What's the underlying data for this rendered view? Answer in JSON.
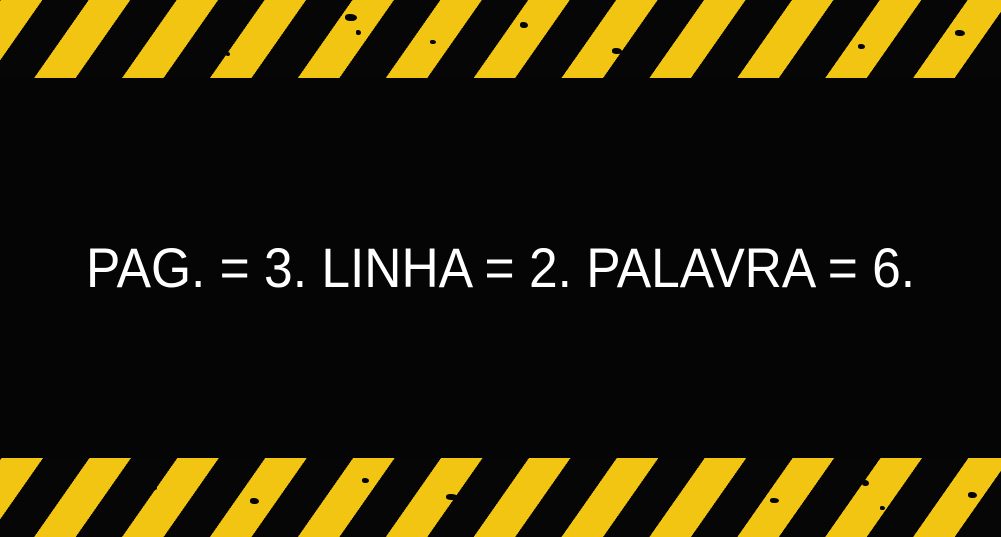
{
  "message": {
    "text": "PAG. = 3. LINHA = 2. PALAVRA = 6."
  },
  "colors": {
    "background": "#050505",
    "stripe_yellow": "#f2c512",
    "stripe_black": "#060606",
    "text": "#ffffff"
  }
}
